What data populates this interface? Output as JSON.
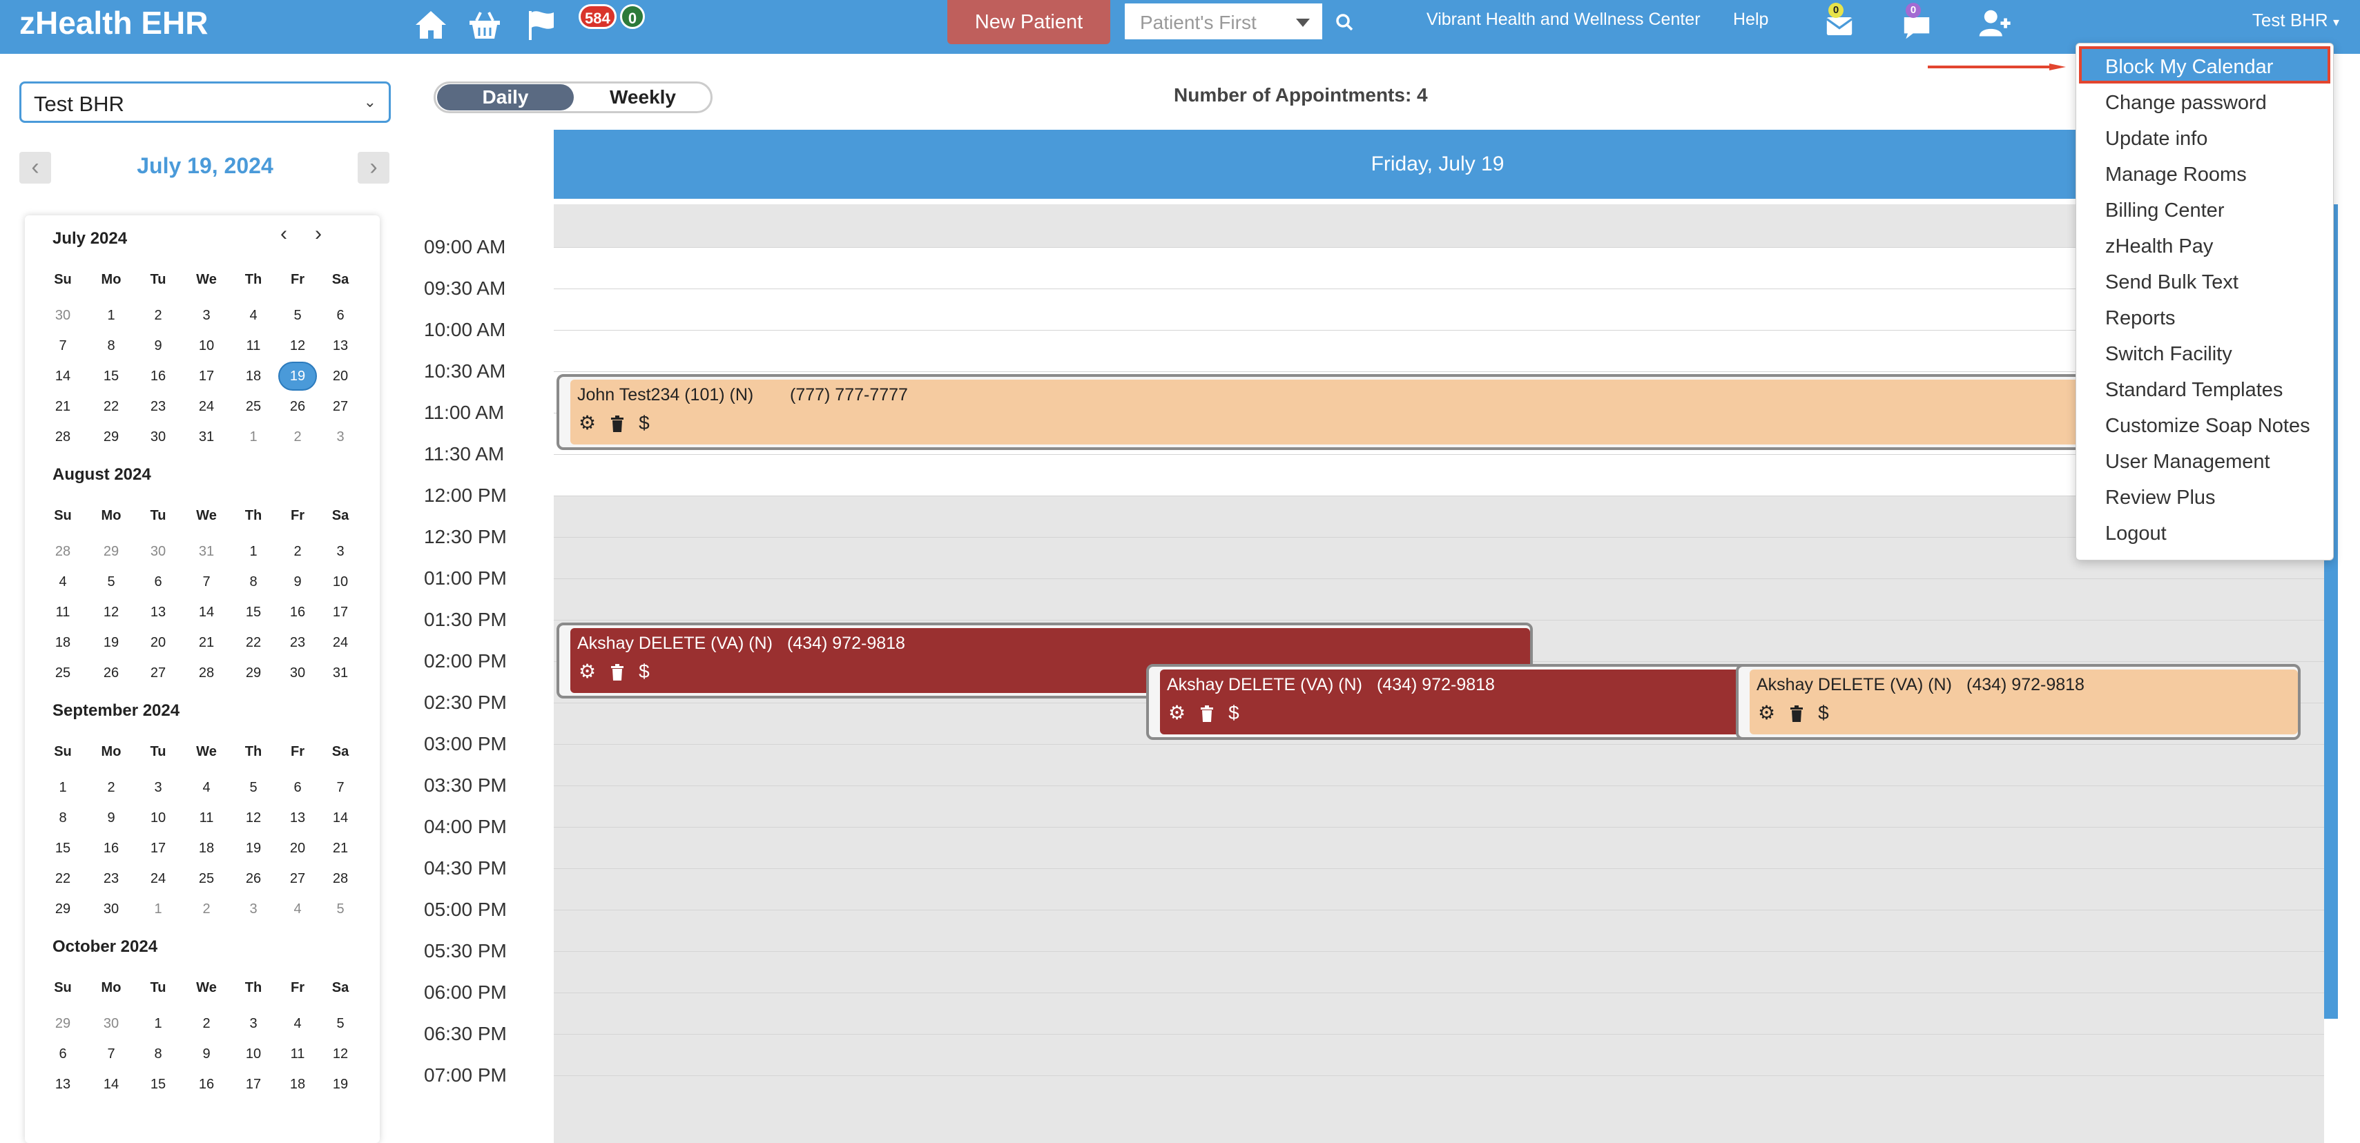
{
  "app": {
    "brand": "zHealth EHR",
    "badge_alerts": "584",
    "badge_count": "0",
    "new_patient": "New Patient",
    "search_placeholder": "Patient's First",
    "facility": "Vibrant Health and Wellness Center",
    "help": "Help",
    "mail_badge": "0",
    "chat_badge": "0",
    "user": "Test BHR"
  },
  "left": {
    "provider": "Test BHR",
    "date_title": "July 19, 2024",
    "months": [
      {
        "title": "July 2024",
        "dow": [
          "Su",
          "Mo",
          "Tu",
          "We",
          "Th",
          "Fr",
          "Sa"
        ],
        "weeks": [
          [
            "30",
            "1",
            "2",
            "3",
            "4",
            "5",
            "6"
          ],
          [
            "7",
            "8",
            "9",
            "10",
            "11",
            "12",
            "13"
          ],
          [
            "14",
            "15",
            "16",
            "17",
            "18",
            "19",
            "20"
          ],
          [
            "21",
            "22",
            "23",
            "24",
            "25",
            "26",
            "27"
          ],
          [
            "28",
            "29",
            "30",
            "31",
            "1",
            "2",
            "3"
          ]
        ],
        "other": [
          [
            0,
            0
          ],
          [
            4,
            4
          ],
          [
            4,
            5
          ],
          [
            4,
            6
          ]
        ],
        "selected": [
          2,
          5
        ]
      },
      {
        "title": "August 2024",
        "dow": [
          "Su",
          "Mo",
          "Tu",
          "We",
          "Th",
          "Fr",
          "Sa"
        ],
        "weeks": [
          [
            "28",
            "29",
            "30",
            "31",
            "1",
            "2",
            "3"
          ],
          [
            "4",
            "5",
            "6",
            "7",
            "8",
            "9",
            "10"
          ],
          [
            "11",
            "12",
            "13",
            "14",
            "15",
            "16",
            "17"
          ],
          [
            "18",
            "19",
            "20",
            "21",
            "22",
            "23",
            "24"
          ],
          [
            "25",
            "26",
            "27",
            "28",
            "29",
            "30",
            "31"
          ]
        ],
        "other": [
          [
            0,
            0
          ],
          [
            0,
            1
          ],
          [
            0,
            2
          ],
          [
            0,
            3
          ]
        ]
      },
      {
        "title": "September 2024",
        "dow": [
          "Su",
          "Mo",
          "Tu",
          "We",
          "Th",
          "Fr",
          "Sa"
        ],
        "weeks": [
          [
            "1",
            "2",
            "3",
            "4",
            "5",
            "6",
            "7"
          ],
          [
            "8",
            "9",
            "10",
            "11",
            "12",
            "13",
            "14"
          ],
          [
            "15",
            "16",
            "17",
            "18",
            "19",
            "20",
            "21"
          ],
          [
            "22",
            "23",
            "24",
            "25",
            "26",
            "27",
            "28"
          ],
          [
            "29",
            "30",
            "1",
            "2",
            "3",
            "4",
            "5"
          ]
        ],
        "other": [
          [
            4,
            2
          ],
          [
            4,
            3
          ],
          [
            4,
            4
          ],
          [
            4,
            5
          ],
          [
            4,
            6
          ]
        ]
      },
      {
        "title": "October 2024",
        "dow": [
          "Su",
          "Mo",
          "Tu",
          "We",
          "Th",
          "Fr",
          "Sa"
        ],
        "weeks": [
          [
            "29",
            "30",
            "1",
            "2",
            "3",
            "4",
            "5"
          ],
          [
            "6",
            "7",
            "8",
            "9",
            "10",
            "11",
            "12"
          ],
          [
            "13",
            "14",
            "15",
            "16",
            "17",
            "18",
            "19"
          ]
        ],
        "other": [
          [
            0,
            0
          ],
          [
            0,
            1
          ]
        ]
      }
    ]
  },
  "view": {
    "daily": "Daily",
    "weekly": "Weekly",
    "appointment_count": "Number of Appointments: 4",
    "day_header": "Friday, July 19"
  },
  "times": [
    "09:00 AM",
    "09:30 AM",
    "10:00 AM",
    "10:30 AM",
    "11:00 AM",
    "11:30 AM",
    "12:00 PM",
    "12:30 PM",
    "01:00 PM",
    "01:30 PM",
    "02:00 PM",
    "02:30 PM",
    "03:00 PM",
    "03:30 PM",
    "04:00 PM",
    "04:30 PM",
    "05:00 PM",
    "05:30 PM",
    "06:00 PM",
    "06:30 PM",
    "07:00 PM"
  ],
  "appointments": [
    {
      "name": "John Test234 (101) (N)",
      "phone": "(777) 777-7777",
      "color": "#f5cba0",
      "text_color": "#222"
    },
    {
      "name": "Akshay DELETE (VA) (N)",
      "phone": "(434) 972-9818",
      "color": "#9a3030",
      "text_color": "#fff"
    },
    {
      "name": "Akshay DELETE (VA) (N)",
      "phone": "(434) 972-9818",
      "color": "#9a3030",
      "text_color": "#fff"
    },
    {
      "name": "Akshay DELETE (VA) (N)",
      "phone": "(434) 972-9818",
      "color": "#f5cba0",
      "text_color": "#222"
    }
  ],
  "menu": {
    "items": [
      "Block My Calendar",
      "Change password",
      "Update info",
      "Manage Rooms",
      "Billing Center",
      "zHealth Pay",
      "Send Bulk Text",
      "Reports",
      "Switch Facility",
      "Standard Templates",
      "Customize Soap Notes",
      "User Management",
      "Review Plus",
      "Logout"
    ],
    "active_index": 0
  },
  "colors": {
    "primary": "#4a9ad9",
    "danger_badge": "#d9342b",
    "count_badge": "#2d7a3a"
  }
}
